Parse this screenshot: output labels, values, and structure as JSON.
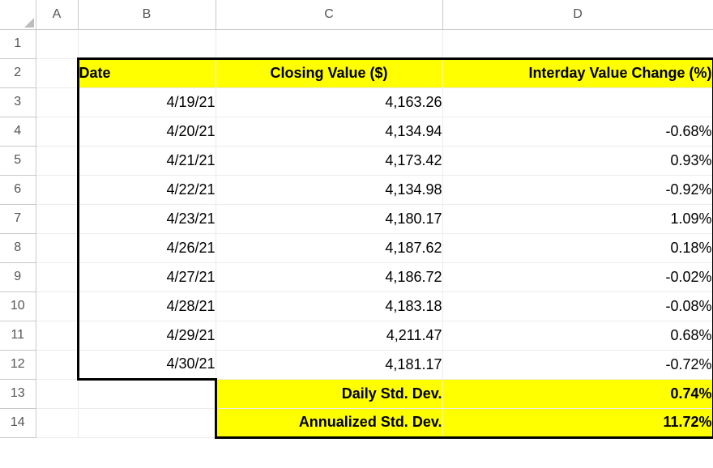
{
  "columns": {
    "A": "A",
    "B": "B",
    "C": "C",
    "D": "D"
  },
  "rowLabels": [
    "1",
    "2",
    "3",
    "4",
    "5",
    "6",
    "7",
    "8",
    "9",
    "10",
    "11",
    "12",
    "13",
    "14"
  ],
  "headers": {
    "date": "Date",
    "closing": "Closing Value ($)",
    "change": "Interday Value Change (%)"
  },
  "rows": [
    {
      "date": "4/19/21",
      "closing": "4,163.26",
      "change": ""
    },
    {
      "date": "4/20/21",
      "closing": "4,134.94",
      "change": "-0.68%"
    },
    {
      "date": "4/21/21",
      "closing": "4,173.42",
      "change": "0.93%"
    },
    {
      "date": "4/22/21",
      "closing": "4,134.98",
      "change": "-0.92%"
    },
    {
      "date": "4/23/21",
      "closing": "4,180.17",
      "change": "1.09%"
    },
    {
      "date": "4/26/21",
      "closing": "4,187.62",
      "change": "0.18%"
    },
    {
      "date": "4/27/21",
      "closing": "4,186.72",
      "change": "-0.02%"
    },
    {
      "date": "4/28/21",
      "closing": "4,183.18",
      "change": "-0.08%"
    },
    {
      "date": "4/29/21",
      "closing": "4,211.47",
      "change": "0.68%"
    },
    {
      "date": "4/30/21",
      "closing": "4,181.17",
      "change": "-0.72%"
    }
  ],
  "summary": {
    "dailyLabel": "Daily Std. Dev.",
    "dailyValue": "0.74%",
    "annualLabel": "Annualized Std. Dev.",
    "annualValue": "11.72%"
  },
  "chart_data": {
    "type": "table",
    "title": "",
    "columns": [
      "Date",
      "Closing Value ($)",
      "Interday Value Change (%)"
    ],
    "data": [
      [
        "4/19/21",
        4163.26,
        null
      ],
      [
        "4/20/21",
        4134.94,
        -0.68
      ],
      [
        "4/21/21",
        4173.42,
        0.93
      ],
      [
        "4/22/21",
        4134.98,
        -0.92
      ],
      [
        "4/23/21",
        4180.17,
        1.09
      ],
      [
        "4/26/21",
        4187.62,
        0.18
      ],
      [
        "4/27/21",
        4186.72,
        -0.02
      ],
      [
        "4/28/21",
        4183.18,
        -0.08
      ],
      [
        "4/29/21",
        4211.47,
        0.68
      ],
      [
        "4/30/21",
        4181.17,
        -0.72
      ]
    ],
    "summary": {
      "Daily Std. Dev.": 0.74,
      "Annualized Std. Dev.": 11.72
    }
  }
}
